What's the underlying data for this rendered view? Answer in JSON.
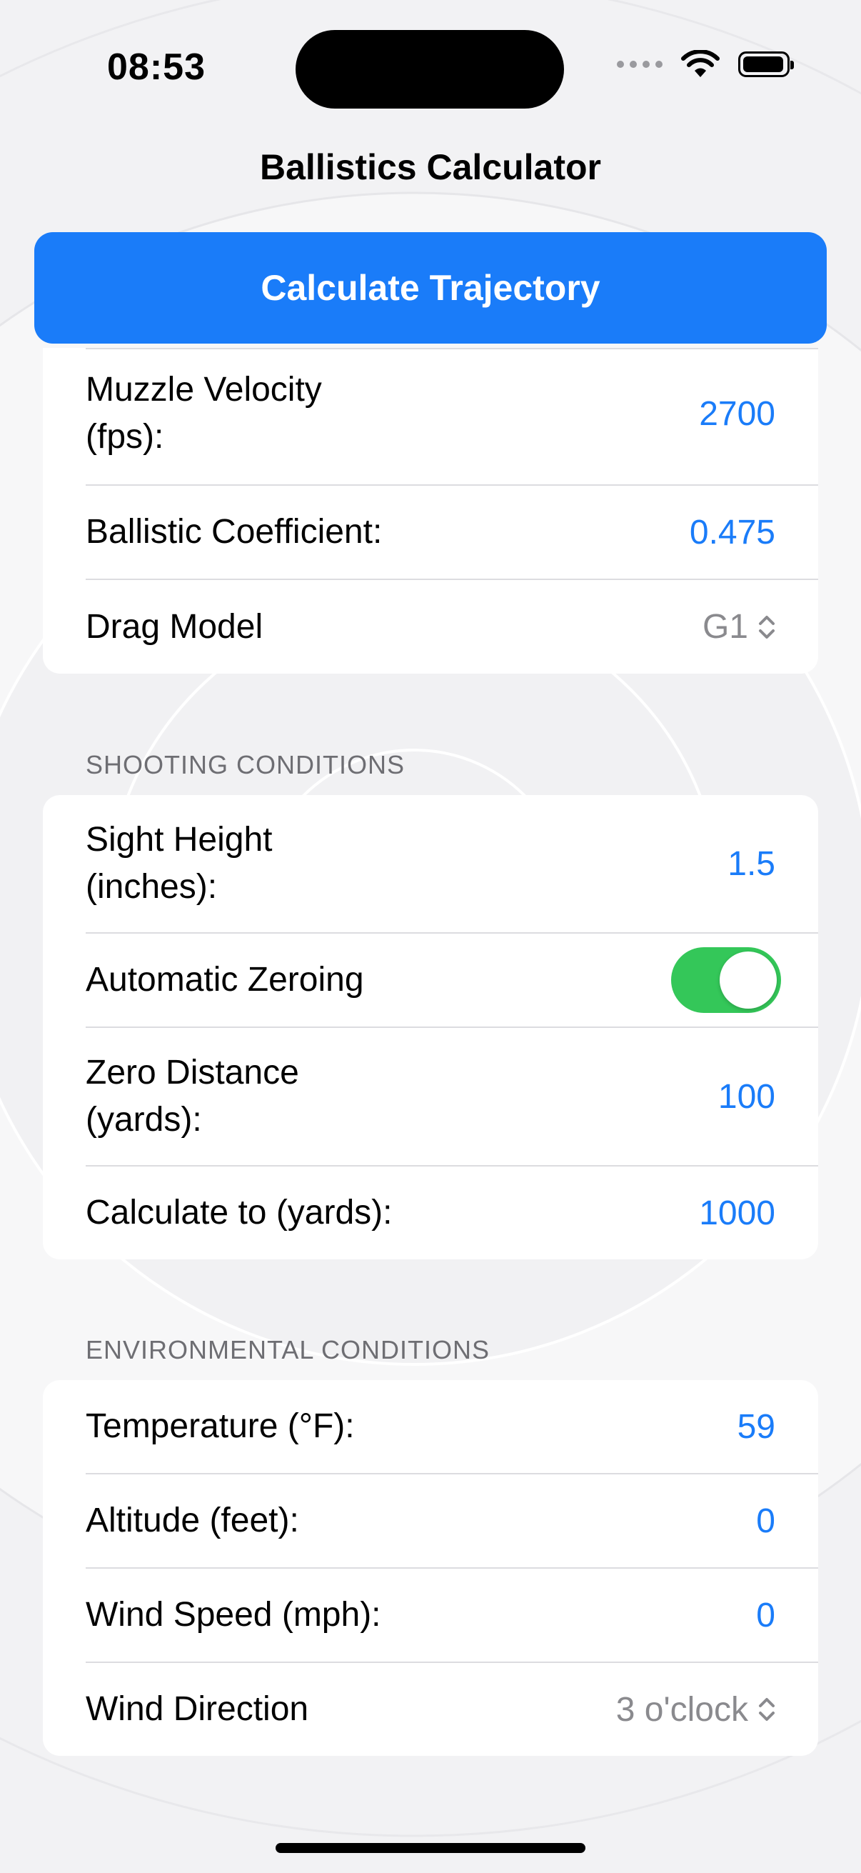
{
  "status_bar": {
    "time": "08:53"
  },
  "nav": {
    "title": "Ballistics Calculator"
  },
  "primary_action": {
    "label": "Calculate Trajectory"
  },
  "projectile": {
    "muzzle_velocity": {
      "label_line1": "Muzzle Velocity",
      "label_line2": "(fps):",
      "value": "2700"
    },
    "ballistic_coefficient": {
      "label": "Ballistic Coefficient:",
      "value": "0.475"
    },
    "drag_model": {
      "label": "Drag Model",
      "value": "G1"
    }
  },
  "shooting": {
    "header": "SHOOTING CONDITIONS",
    "sight_height": {
      "label_line1": "Sight Height",
      "label_line2": "(inches):",
      "value": "1.5"
    },
    "automatic_zeroing": {
      "label": "Automatic Zeroing",
      "on": true
    },
    "zero_distance": {
      "label_line1": "Zero Distance",
      "label_line2": "(yards):",
      "value": "100"
    },
    "calculate_to": {
      "label": "Calculate to (yards):",
      "value": "1000"
    }
  },
  "environment": {
    "header": "ENVIRONMENTAL CONDITIONS",
    "temperature": {
      "label": "Temperature (°F):",
      "value": "59"
    },
    "altitude": {
      "label": "Altitude (feet):",
      "value": "0"
    },
    "wind_speed": {
      "label": "Wind Speed (mph):",
      "value": "0"
    },
    "wind_direction": {
      "label": "Wind Direction",
      "value": "3 o'clock"
    }
  },
  "colors": {
    "accent": "#1a7cf9",
    "toggle_on": "#34c759",
    "secondary_text": "#6e6e73"
  },
  "icons": [
    "wifi-icon",
    "battery-icon",
    "chevron-updown-icon"
  ]
}
